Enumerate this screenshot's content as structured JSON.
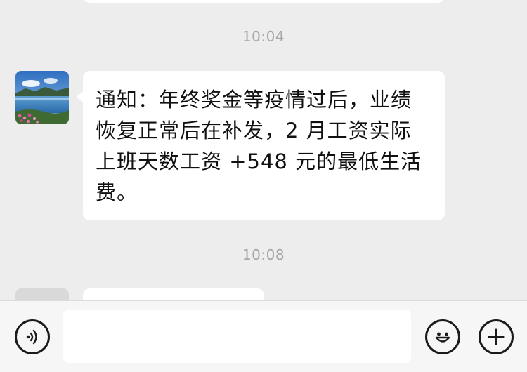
{
  "messages": [
    {
      "time": "10:04",
      "sender_avatar": "landscape-lake-avatar",
      "text": "通知：年终奖金等疫情过后，业绩恢复正常后在补发，2 月工资实际上班天数工资 +548 元的最低生活费。"
    },
    {
      "time": "10:08",
      "sender_avatar": "red-avatar",
      "text": ""
    }
  ],
  "input_bar": {
    "message_value": "",
    "icons": {
      "voice": "voice-icon",
      "emoji": "emoji-icon",
      "more": "plus-icon"
    }
  },
  "colors": {
    "background": "#ededed",
    "bubble": "#ffffff",
    "timestamp": "#a6a6a6",
    "input_bar": "#f6f6f6"
  }
}
